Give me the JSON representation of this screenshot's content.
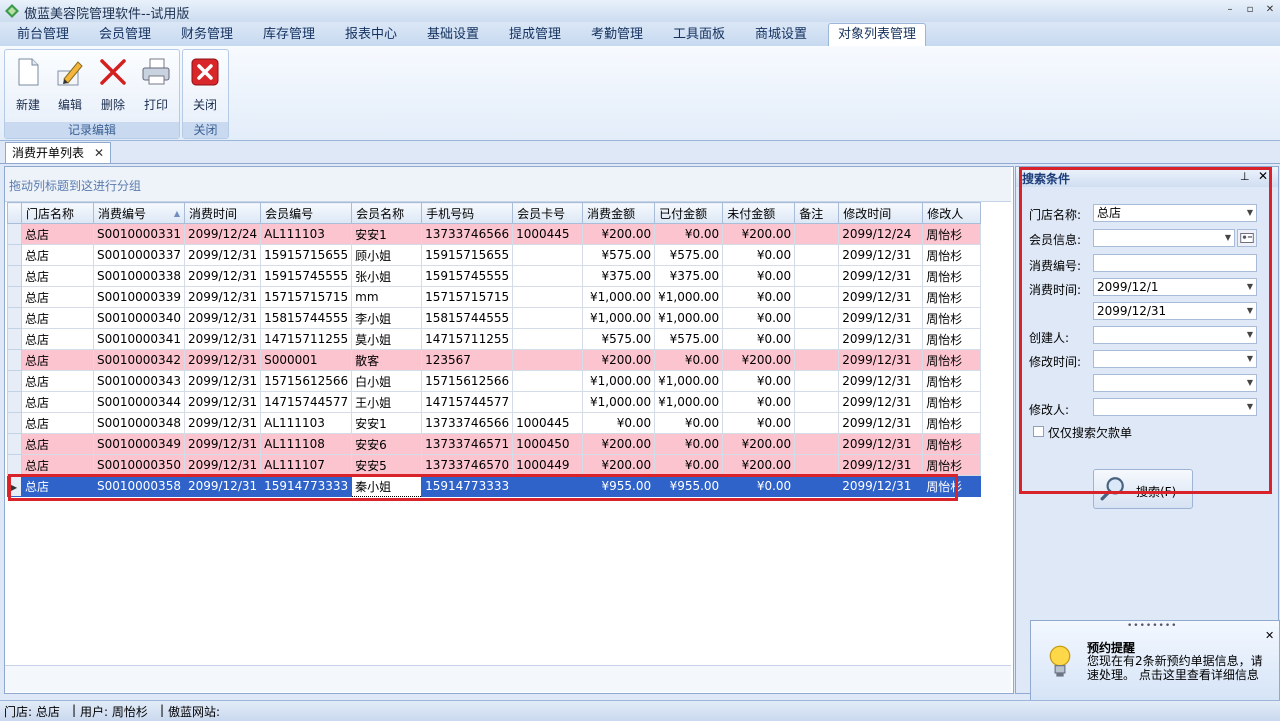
{
  "window": {
    "title": "傲蓝美容院管理软件--试用版"
  },
  "menu": {
    "tabs": [
      {
        "label": "前台管理"
      },
      {
        "label": "会员管理"
      },
      {
        "label": "财务管理"
      },
      {
        "label": "库存管理"
      },
      {
        "label": "报表中心"
      },
      {
        "label": "基础设置"
      },
      {
        "label": "提成管理"
      },
      {
        "label": "考勤管理"
      },
      {
        "label": "工具面板"
      },
      {
        "label": "商城设置"
      },
      {
        "label": "对象列表管理"
      }
    ],
    "active_index": 10
  },
  "ribbon": {
    "record_group": {
      "label": "记录编辑",
      "buttons": [
        {
          "label": "新建",
          "icon": "new-document-icon"
        },
        {
          "label": "编辑",
          "icon": "pencil-edit-icon"
        },
        {
          "label": "删除",
          "icon": "delete-x-icon"
        },
        {
          "label": "打印",
          "icon": "printer-icon"
        }
      ]
    },
    "close_group": {
      "label": "关闭",
      "buttons": [
        {
          "label": "关闭",
          "icon": "close-red-icon"
        }
      ]
    }
  },
  "document_tab": {
    "label": "消费开单列表"
  },
  "grid": {
    "group_hint": "拖动列标题到这进行分组",
    "columns": [
      "门店名称",
      "消费编号",
      "消费时间",
      "会员编号",
      "会员名称",
      "手机号码",
      "会员卡号",
      "消费金额",
      "已付金额",
      "未付金额",
      "备注",
      "修改时间",
      "修改人"
    ],
    "rows": [
      {
        "store": "总店",
        "no": "S0010000331",
        "time": "2099/12/24",
        "member_no": "AL111103",
        "member_name": "安安1",
        "phone": "13733746566",
        "card": "1000445",
        "amount": "¥200.00",
        "paid": "¥0.00",
        "unpaid": "¥200.00",
        "note": "",
        "mtime": "2099/12/24",
        "editor": "周怡杉",
        "highlight": "pink"
      },
      {
        "store": "总店",
        "no": "S0010000337",
        "time": "2099/12/31",
        "member_no": "15915715655",
        "member_name": "顾小姐",
        "phone": "15915715655",
        "card": "",
        "amount": "¥575.00",
        "paid": "¥575.00",
        "unpaid": "¥0.00",
        "note": "",
        "mtime": "2099/12/31",
        "editor": "周怡杉",
        "highlight": ""
      },
      {
        "store": "总店",
        "no": "S0010000338",
        "time": "2099/12/31",
        "member_no": "15915745555",
        "member_name": "张小姐",
        "phone": "15915745555",
        "card": "",
        "amount": "¥375.00",
        "paid": "¥375.00",
        "unpaid": "¥0.00",
        "note": "",
        "mtime": "2099/12/31",
        "editor": "周怡杉",
        "highlight": ""
      },
      {
        "store": "总店",
        "no": "S0010000339",
        "time": "2099/12/31",
        "member_no": "15715715715",
        "member_name": "mm",
        "phone": "15715715715",
        "card": "",
        "amount": "¥1,000.00",
        "paid": "¥1,000.00",
        "unpaid": "¥0.00",
        "note": "",
        "mtime": "2099/12/31",
        "editor": "周怡杉",
        "highlight": ""
      },
      {
        "store": "总店",
        "no": "S0010000340",
        "time": "2099/12/31",
        "member_no": "15815744555",
        "member_name": "李小姐",
        "phone": "15815744555",
        "card": "",
        "amount": "¥1,000.00",
        "paid": "¥1,000.00",
        "unpaid": "¥0.00",
        "note": "",
        "mtime": "2099/12/31",
        "editor": "周怡杉",
        "highlight": ""
      },
      {
        "store": "总店",
        "no": "S0010000341",
        "time": "2099/12/31",
        "member_no": "14715711255",
        "member_name": "莫小姐",
        "phone": "14715711255",
        "card": "",
        "amount": "¥575.00",
        "paid": "¥575.00",
        "unpaid": "¥0.00",
        "note": "",
        "mtime": "2099/12/31",
        "editor": "周怡杉",
        "highlight": ""
      },
      {
        "store": "总店",
        "no": "S0010000342",
        "time": "2099/12/31",
        "member_no": "S000001",
        "member_name": "散客",
        "phone": "123567",
        "card": "",
        "amount": "¥200.00",
        "paid": "¥0.00",
        "unpaid": "¥200.00",
        "note": "",
        "mtime": "2099/12/31",
        "editor": "周怡杉",
        "highlight": "pink"
      },
      {
        "store": "总店",
        "no": "S0010000343",
        "time": "2099/12/31",
        "member_no": "15715612566",
        "member_name": "白小姐",
        "phone": "15715612566",
        "card": "",
        "amount": "¥1,000.00",
        "paid": "¥1,000.00",
        "unpaid": "¥0.00",
        "note": "",
        "mtime": "2099/12/31",
        "editor": "周怡杉",
        "highlight": ""
      },
      {
        "store": "总店",
        "no": "S0010000344",
        "time": "2099/12/31",
        "member_no": "14715744577",
        "member_name": "王小姐",
        "phone": "14715744577",
        "card": "",
        "amount": "¥1,000.00",
        "paid": "¥1,000.00",
        "unpaid": "¥0.00",
        "note": "",
        "mtime": "2099/12/31",
        "editor": "周怡杉",
        "highlight": ""
      },
      {
        "store": "总店",
        "no": "S0010000348",
        "time": "2099/12/31",
        "member_no": "AL111103",
        "member_name": "安安1",
        "phone": "13733746566",
        "card": "1000445",
        "amount": "¥0.00",
        "paid": "¥0.00",
        "unpaid": "¥0.00",
        "note": "",
        "mtime": "2099/12/31",
        "editor": "周怡杉",
        "highlight": ""
      },
      {
        "store": "总店",
        "no": "S0010000349",
        "time": "2099/12/31",
        "member_no": "AL111108",
        "member_name": "安安6",
        "phone": "13733746571",
        "card": "1000450",
        "amount": "¥200.00",
        "paid": "¥0.00",
        "unpaid": "¥200.00",
        "note": "",
        "mtime": "2099/12/31",
        "editor": "周怡杉",
        "highlight": "pink"
      },
      {
        "store": "总店",
        "no": "S0010000350",
        "time": "2099/12/31",
        "member_no": "AL111107",
        "member_name": "安安5",
        "phone": "13733746570",
        "card": "1000449",
        "amount": "¥200.00",
        "paid": "¥0.00",
        "unpaid": "¥200.00",
        "note": "",
        "mtime": "2099/12/31",
        "editor": "周怡杉",
        "highlight": "pink"
      },
      {
        "store": "总店",
        "no": "S0010000358",
        "time": "2099/12/31",
        "member_no": "15914773333",
        "member_name": "秦小姐",
        "phone": "15914773333",
        "card": "",
        "amount": "¥955.00",
        "paid": "¥955.00",
        "unpaid": "¥0.00",
        "note": "",
        "mtime": "2099/12/31",
        "editor": "周怡杉",
        "highlight": "selected"
      }
    ]
  },
  "search": {
    "title": "搜索条件",
    "store_label": "门店名称:",
    "store_value": "总店",
    "member_label": "会员信息:",
    "member_value": "",
    "consume_no_label": "消费编号:",
    "consume_no_value": "",
    "consume_time_label": "消费时间:",
    "consume_time_from": "2099/12/1",
    "consume_time_to": "2099/12/31",
    "creator_label": "创建人:",
    "creator_value": "",
    "mtime_label": "修改时间:",
    "mtime_from": "",
    "mtime_to": "",
    "editor_label": "修改人:",
    "editor_value": "",
    "only_debt_label": "仅仅搜索欠款单",
    "only_debt_checked": false,
    "button_label": "搜索(F)"
  },
  "notification": {
    "title": "预约提醒",
    "body": "您现在有2条新预约单据信息，请速处理。 点击这里查看详细信息"
  },
  "status": {
    "store": "门店: 总店",
    "user": "用户: 周怡杉",
    "site": "傲蓝网站:"
  },
  "colors": {
    "accent": "#2f63c9",
    "debt_row": "#fcc4cf",
    "highlight_box": "#d9232a"
  }
}
